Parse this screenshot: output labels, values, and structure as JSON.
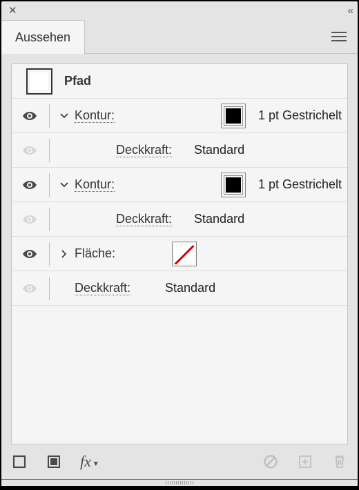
{
  "panel": {
    "tab_label": "Aussehen",
    "object_type": "Pfad"
  },
  "rows": [
    {
      "kind": "stroke",
      "label": "Kontur:",
      "swatch": "black",
      "value": "1 pt Gestrichelt",
      "expanded": true,
      "visible": true
    },
    {
      "kind": "opacity",
      "label": "Deckkraft:",
      "value": "Standard",
      "visible": false
    },
    {
      "kind": "stroke",
      "label": "Kontur:",
      "swatch": "black",
      "value": "1 pt Gestrichelt",
      "expanded": true,
      "visible": true
    },
    {
      "kind": "opacity",
      "label": "Deckkraft:",
      "value": "Standard",
      "visible": false
    },
    {
      "kind": "fill",
      "label": "Fläche:",
      "swatch": "none",
      "expanded": false,
      "visible": true
    },
    {
      "kind": "opacity",
      "label": "Deckkraft:",
      "value": "Standard",
      "visible": false,
      "topLevel": true
    }
  ],
  "footer": {
    "fx_label": "fx"
  }
}
